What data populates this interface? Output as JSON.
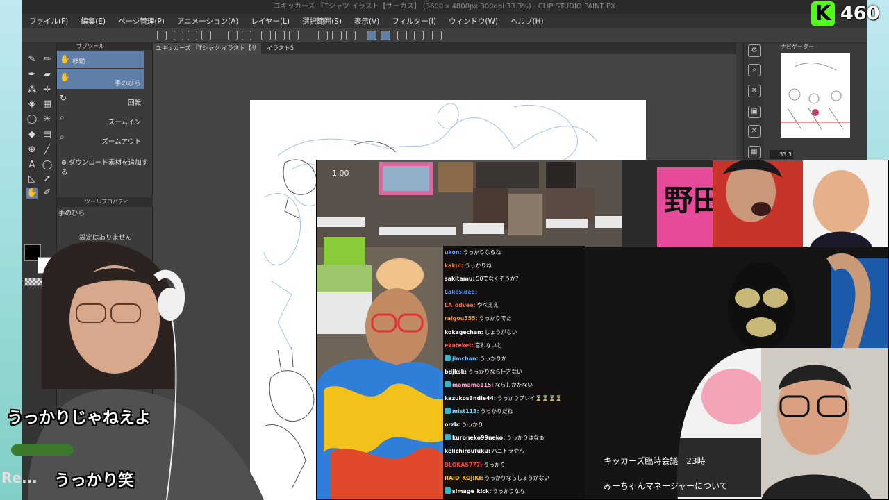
{
  "app": {
    "window_title": "ユキッカーズ 『Tシャツ イラスト【サーカス】 (3600 x 4800px 300dpi 33.3%) - CLIP STUDIO PAINT EX"
  },
  "menu": [
    "ファイル(F)",
    "編集(E)",
    "ページ管理(P)",
    "アニメーション(A)",
    "レイヤー(L)",
    "選択範囲(S)",
    "表示(V)",
    "フィルター(I)",
    "ウィンドウ(W)",
    "ヘルプ(H)"
  ],
  "subtool": {
    "header": "サブツール",
    "items": [
      {
        "label": "移動",
        "sub": ""
      },
      {
        "label": "",
        "sub": "手のひら"
      },
      {
        "label": "",
        "sub": "回転"
      },
      {
        "label": "",
        "sub": "ズームイン"
      },
      {
        "label": "",
        "sub": "ズームアウト"
      }
    ],
    "add_material": "ダウンロード素材を追加する"
  },
  "tool_property": {
    "header": "ツールプロパティ",
    "tool_name": "手のひら",
    "empty_text": "設定はありません"
  },
  "tabs": [
    {
      "label": "ユキッカーズ 『Tシャツ イラスト【サーカス】*"
    },
    {
      "label": "イラスト5"
    }
  ],
  "navigator": {
    "header": "ナビゲーター",
    "zoom": "33.3"
  },
  "stream": {
    "platform_badge": "K",
    "viewer_count": "460",
    "subtitle_top": "うっかりじゃねえよ",
    "subtitle_bottom": "うっかり笑",
    "subtitle_prefix": "Re...",
    "video_counter": "1.00",
    "caption_line1": "キッカーズ臨時会議　23時",
    "caption_line2": "みーちゃんマネージャーについて",
    "banner_text": "野田"
  },
  "chat": [
    {
      "user": "ukon:",
      "msg": "うっかりならね",
      "color": "#5f9fff",
      "badge": false
    },
    {
      "user": "kakul:",
      "msg": "うっかりね",
      "color": "#ff7b3a",
      "badge": false
    },
    {
      "user": "sakitamu:",
      "msg": "50でなくそうか？",
      "color": "#ffffff",
      "badge": false
    },
    {
      "user": "Lakesidee:",
      "msg": "",
      "color": "#4f8fff",
      "badge": false
    },
    {
      "user": "LA_odvee:",
      "msg": "やべええ",
      "color": "#ff6a3a",
      "badge": false
    },
    {
      "user": "raigou555:",
      "msg": "うっかりでた",
      "color": "#ff8c2a",
      "badge": false
    },
    {
      "user": "kokagechan:",
      "msg": "しょうがない",
      "color": "#ffffff",
      "badge": false
    },
    {
      "user": "ekateket:",
      "msg": "言わないと",
      "color": "#ff5a5a",
      "badge": false
    },
    {
      "user": "jimchan:",
      "msg": "うっかりか",
      "color": "#5fb5ff",
      "badge": true
    },
    {
      "user": "bdjksk:",
      "msg": "うっかりなら仕方ない",
      "color": "#ffffff",
      "badge": false
    },
    {
      "user": "mamama115:",
      "msg": "ならしかたない",
      "color": "#ff9ad2",
      "badge": true
    },
    {
      "user": "kazukos3ndie44:",
      "msg": "うっかりプレイ⏳⏳⏳⏳",
      "color": "#ffffff",
      "badge": false
    },
    {
      "user": "mist113:",
      "msg": "うっかりだね",
      "color": "#7fd7ff",
      "badge": true
    },
    {
      "user": "orzb:",
      "msg": "うっかり",
      "color": "#ffffff",
      "badge": false
    },
    {
      "user": "kuroneko99neko:",
      "msg": "うっかりはなぁ",
      "color": "#ffffff",
      "badge": true
    },
    {
      "user": "kelichiroufuku:",
      "msg": "ハニトラやん",
      "color": "#ffffff",
      "badge": false
    },
    {
      "user": "BLOKAS777:",
      "msg": "うっかり",
      "color": "#ff3a3a",
      "badge": false
    },
    {
      "user": "RAID_KOJIKI:",
      "msg": "うっかりならしょうがない",
      "color": "#ffd12a",
      "badge": false
    },
    {
      "user": "simage_kick:",
      "msg": "うっかりなな",
      "color": "#ffffff",
      "badge": true
    }
  ]
}
